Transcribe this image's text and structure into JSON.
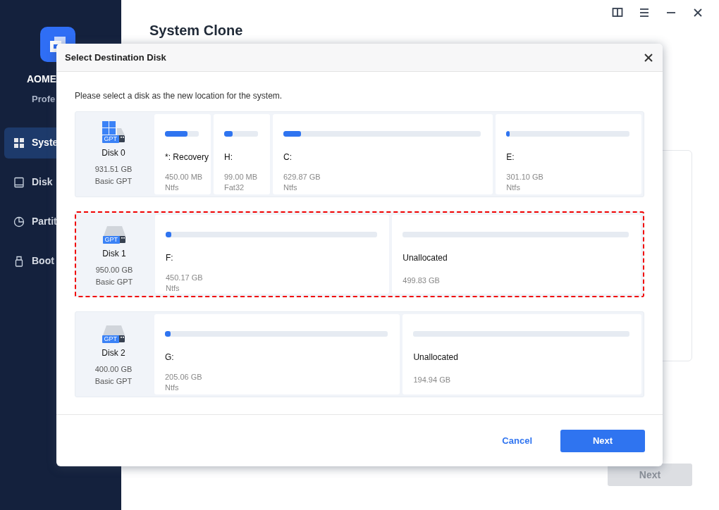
{
  "sidebar": {
    "brand": "AOME",
    "edition": "Profe",
    "items": [
      {
        "kind": "system",
        "label": "Syste",
        "selected": true
      },
      {
        "kind": "disk",
        "label": "Disk",
        "selected": false
      },
      {
        "kind": "partition",
        "label": "Partit",
        "selected": false
      },
      {
        "kind": "bootable",
        "label": "Boot",
        "selected": false
      }
    ]
  },
  "page": {
    "title": "System Clone",
    "next_button": {
      "label": "Next",
      "disabled": true
    }
  },
  "dialog": {
    "title": "Select Destination Disk",
    "prompt": "Please select a disk as the new location for the system.",
    "disks": [
      {
        "name": "Disk 0",
        "badge": "GPT",
        "system": true,
        "size": "931.51 GB",
        "type": "Basic GPT",
        "selected": false,
        "partitions": [
          {
            "name": "*: Recovery",
            "size": "450.00 MB",
            "fs": "Ntfs",
            "level": 0.66
          },
          {
            "name": "H:",
            "size": "99.00 MB",
            "fs": "Fat32",
            "level": 0.25
          },
          {
            "name": "C:",
            "size": "629.87 GB",
            "fs": "Ntfs",
            "level": 0.09
          },
          {
            "name": "E:",
            "size": "301.10 GB",
            "fs": "Ntfs",
            "level": 0.02
          }
        ]
      },
      {
        "name": "Disk 1",
        "badge": "GPT",
        "system": false,
        "size": "950.00 GB",
        "type": "Basic GPT",
        "selected": true,
        "partitions": [
          {
            "name": "F:",
            "size": "450.17 GB",
            "fs": "Ntfs",
            "level": 0.01
          },
          {
            "name": "Unallocated",
            "size": "499.83 GB"
          }
        ]
      },
      {
        "name": "Disk 2",
        "badge": "GPT",
        "system": false,
        "size": "400.00 GB",
        "type": "Basic GPT",
        "selected": false,
        "partitions": [
          {
            "name": "G:",
            "size": "205.06 GB",
            "fs": "Ntfs",
            "level": 0.02
          },
          {
            "name": "Unallocated",
            "size": "194.94 GB"
          }
        ]
      }
    ],
    "cancel": "Cancel",
    "next": "Next"
  }
}
